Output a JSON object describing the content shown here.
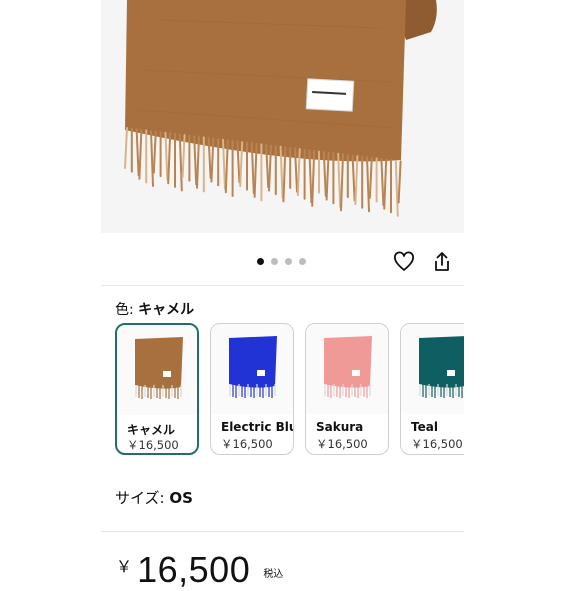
{
  "product_image": {
    "alt_dots_count": 4,
    "active_index": 0,
    "scarf_color": "#a8703f",
    "label_text": "THE INOUE BROTHERS..."
  },
  "actions": {
    "favorite_icon": "heart-outline-icon",
    "share_icon": "share-icon"
  },
  "color_selector": {
    "label": "色:",
    "selected_value": "キャメル",
    "options": [
      {
        "name": "キャメル",
        "price": "￥16,500",
        "color": "#a8703f"
      },
      {
        "name": "Electric Blue",
        "price": "￥16,500",
        "color": "#2233d6"
      },
      {
        "name": "Sakura",
        "price": "￥16,500",
        "color": "#f09a98"
      },
      {
        "name": "Teal",
        "price": "￥16,500",
        "color": "#0e5f62"
      }
    ]
  },
  "size_selector": {
    "label": "サイズ:",
    "value": "OS"
  },
  "price": {
    "currency": "￥",
    "amount": "16,500",
    "tax_note": "税込"
  }
}
